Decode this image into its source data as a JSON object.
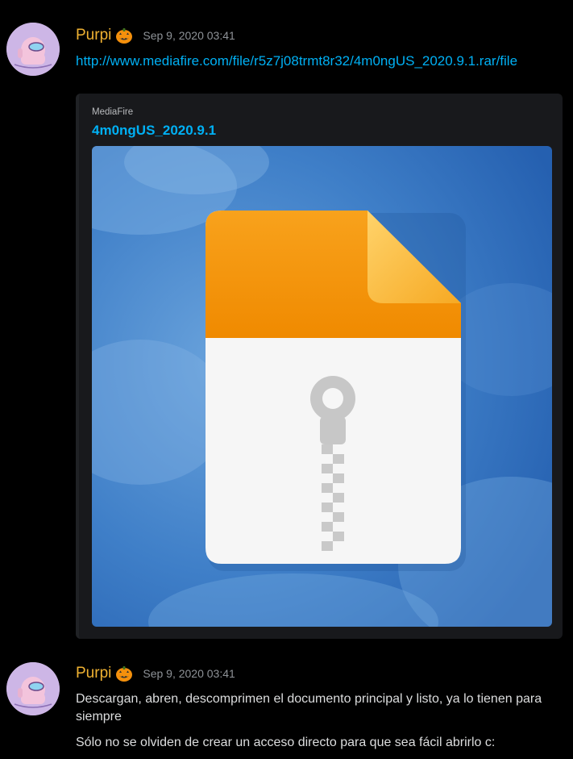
{
  "messages": [
    {
      "author": "Purpi",
      "timestamp": "Sep 9, 2020 03:41",
      "link": "http://www.mediafire.com/file/r5z7j08trmt8r32/4m0ngUS_2020.9.1.rar/file",
      "embed": {
        "provider": "MediaFire",
        "title": "4m0ngUS_2020.9.1"
      }
    },
    {
      "author": "Purpi",
      "timestamp": "Sep 9, 2020 03:41",
      "lines": [
        "Descargan, abren, descomprimen el documento principal y listo, ya lo tienen para siempre",
        "Sólo no se olviden de crear un acceso directo para que sea fácil abrirlo c:"
      ]
    }
  ],
  "colors": {
    "background": "#000000",
    "username": "#f0b232",
    "link": "#00b0f4",
    "timestamp": "#8e9297",
    "embed_bg": "#18191c"
  },
  "icons": {
    "pumpkin": "jack-o-lantern-emoji",
    "file": "zip-file-icon"
  }
}
